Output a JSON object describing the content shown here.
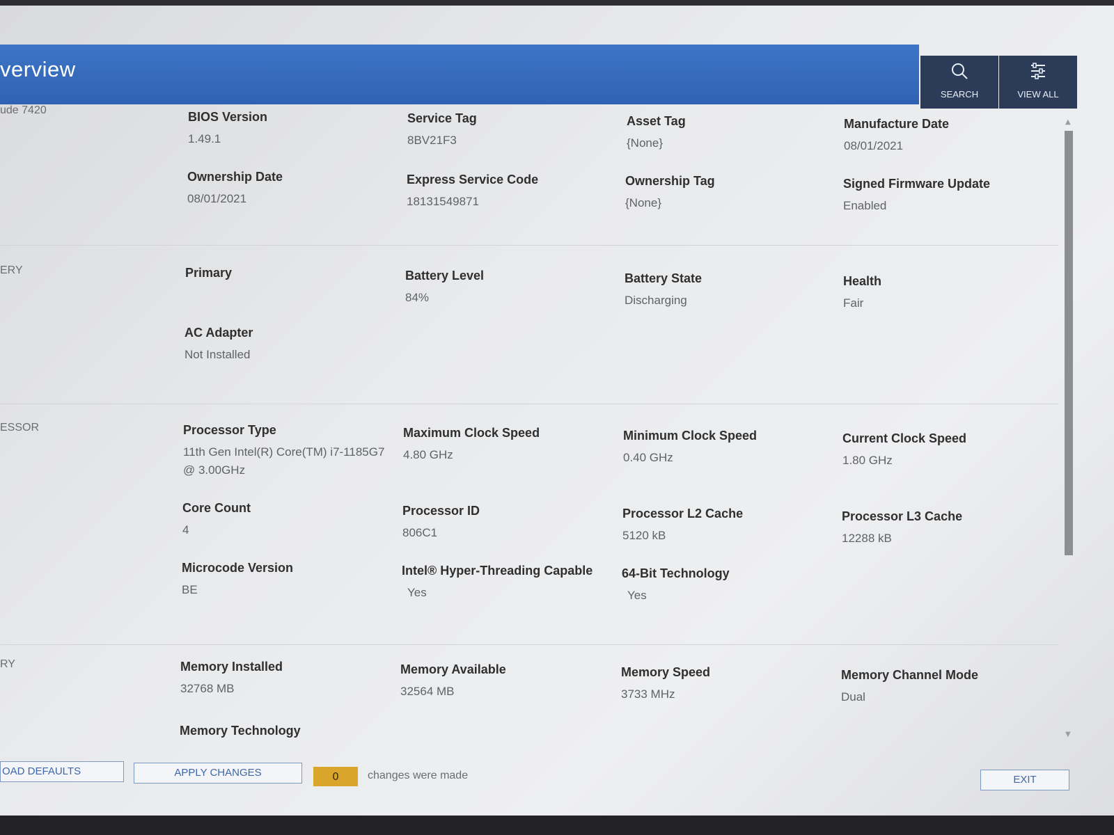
{
  "header": {
    "title": "verview",
    "search": {
      "label": "SEARCH",
      "icon": "search-icon"
    },
    "view_all": {
      "label": "VIEW ALL",
      "icon": "sliders-icon"
    },
    "accent": "#2f62b3"
  },
  "sections": [
    {
      "name": "ude 7420",
      "fields": [
        {
          "label": "BIOS Version",
          "value": "1.49.1"
        },
        {
          "label": "Service Tag",
          "value": "8BV21F3"
        },
        {
          "label": "Asset Tag",
          "value": "{None}"
        },
        {
          "label": "Manufacture Date",
          "value": "08/01/2021"
        },
        {
          "label": "Ownership Date",
          "value": "08/01/2021"
        },
        {
          "label": "Express Service Code",
          "value": "18131549871"
        },
        {
          "label": "Ownership Tag",
          "value": "{None}"
        },
        {
          "label": "Signed Firmware Update",
          "value": "Enabled"
        }
      ]
    },
    {
      "name": "ERY",
      "fields": [
        {
          "label": "Primary",
          "value": ""
        },
        {
          "label": "Battery Level",
          "value": "84%"
        },
        {
          "label": "Battery State",
          "value": "Discharging"
        },
        {
          "label": "Health",
          "value": "Fair"
        },
        {
          "label": "AC Adapter",
          "value": "Not Installed"
        }
      ]
    },
    {
      "name": "ESSOR",
      "fields": [
        {
          "label": "Processor Type",
          "value": "11th Gen Intel(R) Core(TM) i7-1185G7 @ 3.00GHz"
        },
        {
          "label": "Maximum Clock Speed",
          "value": "4.80 GHz"
        },
        {
          "label": "Minimum Clock Speed",
          "value": "0.40 GHz"
        },
        {
          "label": "Current Clock Speed",
          "value": "1.80 GHz"
        },
        {
          "label": "Core Count",
          "value": "4"
        },
        {
          "label": "Processor ID",
          "value": "806C1"
        },
        {
          "label": "Processor L2 Cache",
          "value": "5120 kB"
        },
        {
          "label": "Processor L3 Cache",
          "value": "12288 kB"
        },
        {
          "label": "Microcode Version",
          "value": "BE"
        },
        {
          "label": "Intel® Hyper-Threading Capable",
          "value": "Yes"
        },
        {
          "label": "64-Bit Technology",
          "value": "Yes"
        }
      ]
    },
    {
      "name": "RY",
      "fields": [
        {
          "label": "Memory Installed",
          "value": "32768 MB"
        },
        {
          "label": "Memory Available",
          "value": "32564 MB"
        },
        {
          "label": "Memory Speed",
          "value": "3733 MHz"
        },
        {
          "label": "Memory Channel Mode",
          "value": "Dual"
        },
        {
          "label": "Memory Technology",
          "value": ""
        }
      ]
    }
  ],
  "footer": {
    "load_defaults": "OAD DEFAULTS",
    "apply_changes": "APPLY CHANGES",
    "changes_count": "0",
    "changes_text": "changes were made",
    "exit": "EXIT",
    "counter_color": "#d9a52a"
  }
}
